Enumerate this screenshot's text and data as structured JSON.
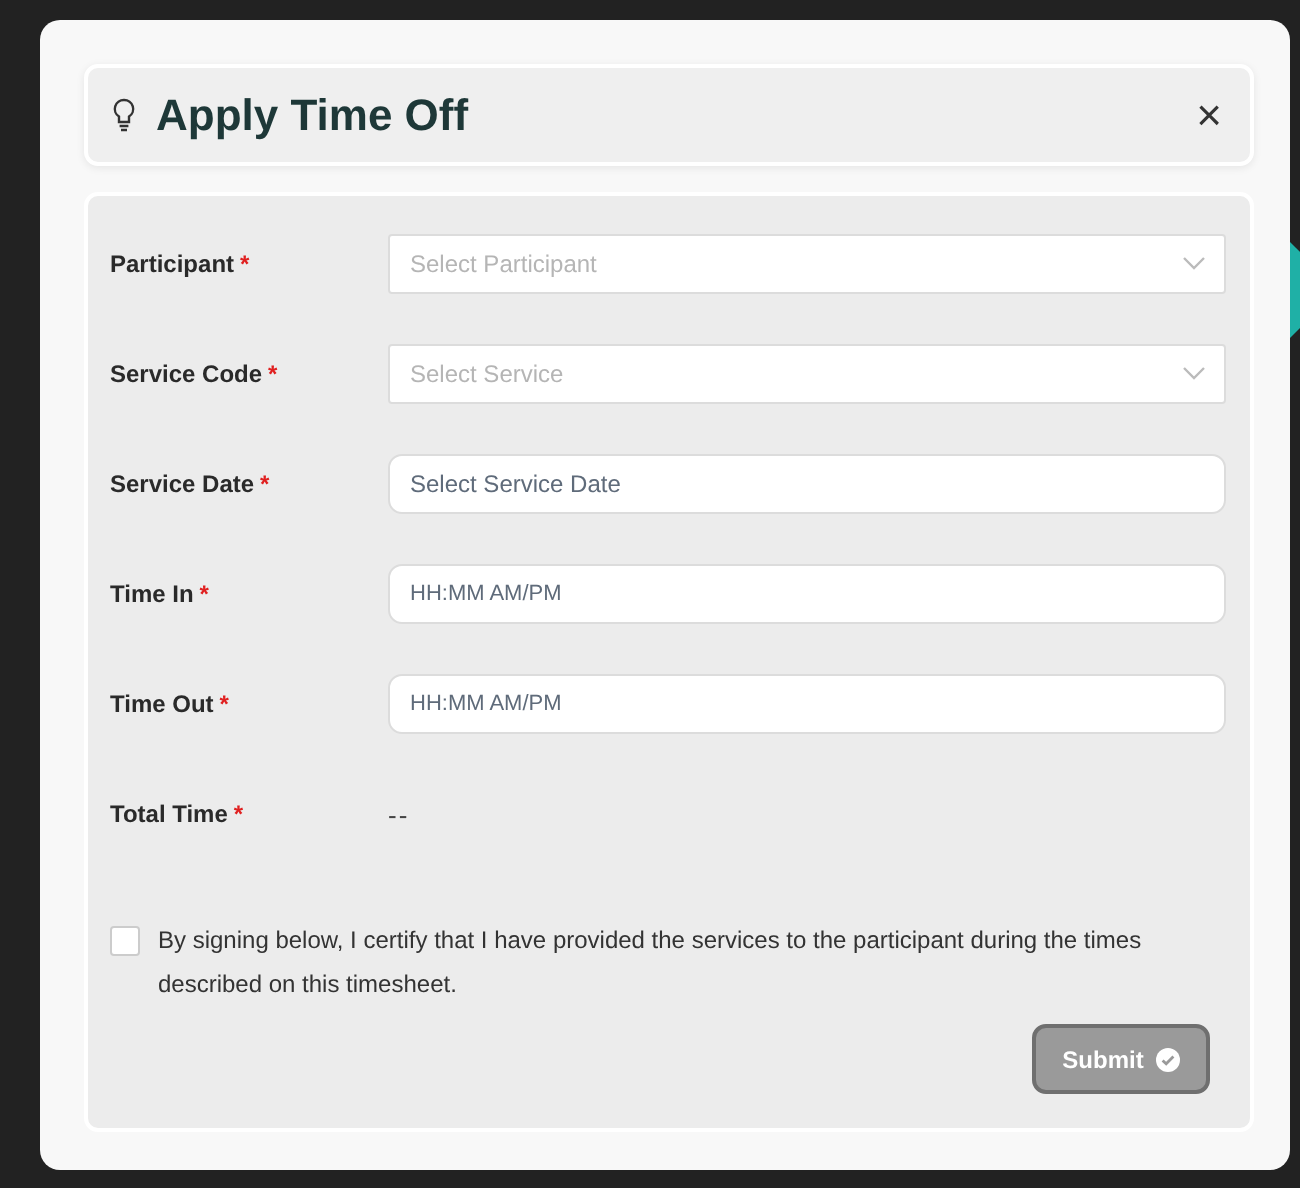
{
  "dialog": {
    "title": "Apply Time Off",
    "close": "×"
  },
  "fields": [
    {
      "kind": "select",
      "label": "Participant",
      "required": "*",
      "placeholder": "Select Participant"
    },
    {
      "kind": "select",
      "label": "Service Code",
      "required": "*",
      "placeholder": "Select Service"
    },
    {
      "kind": "date",
      "label": "Service Date",
      "required": "*",
      "placeholder": "Select Service Date"
    },
    {
      "kind": "time",
      "label": "Time In",
      "required": "*",
      "placeholder": "HH:MM AM/PM"
    },
    {
      "kind": "time",
      "label": "Time Out",
      "required": "*",
      "placeholder": "HH:MM AM/PM"
    },
    {
      "kind": "readout",
      "label": "Total Time",
      "required": "*",
      "value": "--"
    }
  ],
  "certify": {
    "checked": false,
    "text": "By signing below, I certify that I have provided the services to the participant during the times described on this timesheet."
  },
  "submit": {
    "label": "Submit",
    "disabled": true
  }
}
